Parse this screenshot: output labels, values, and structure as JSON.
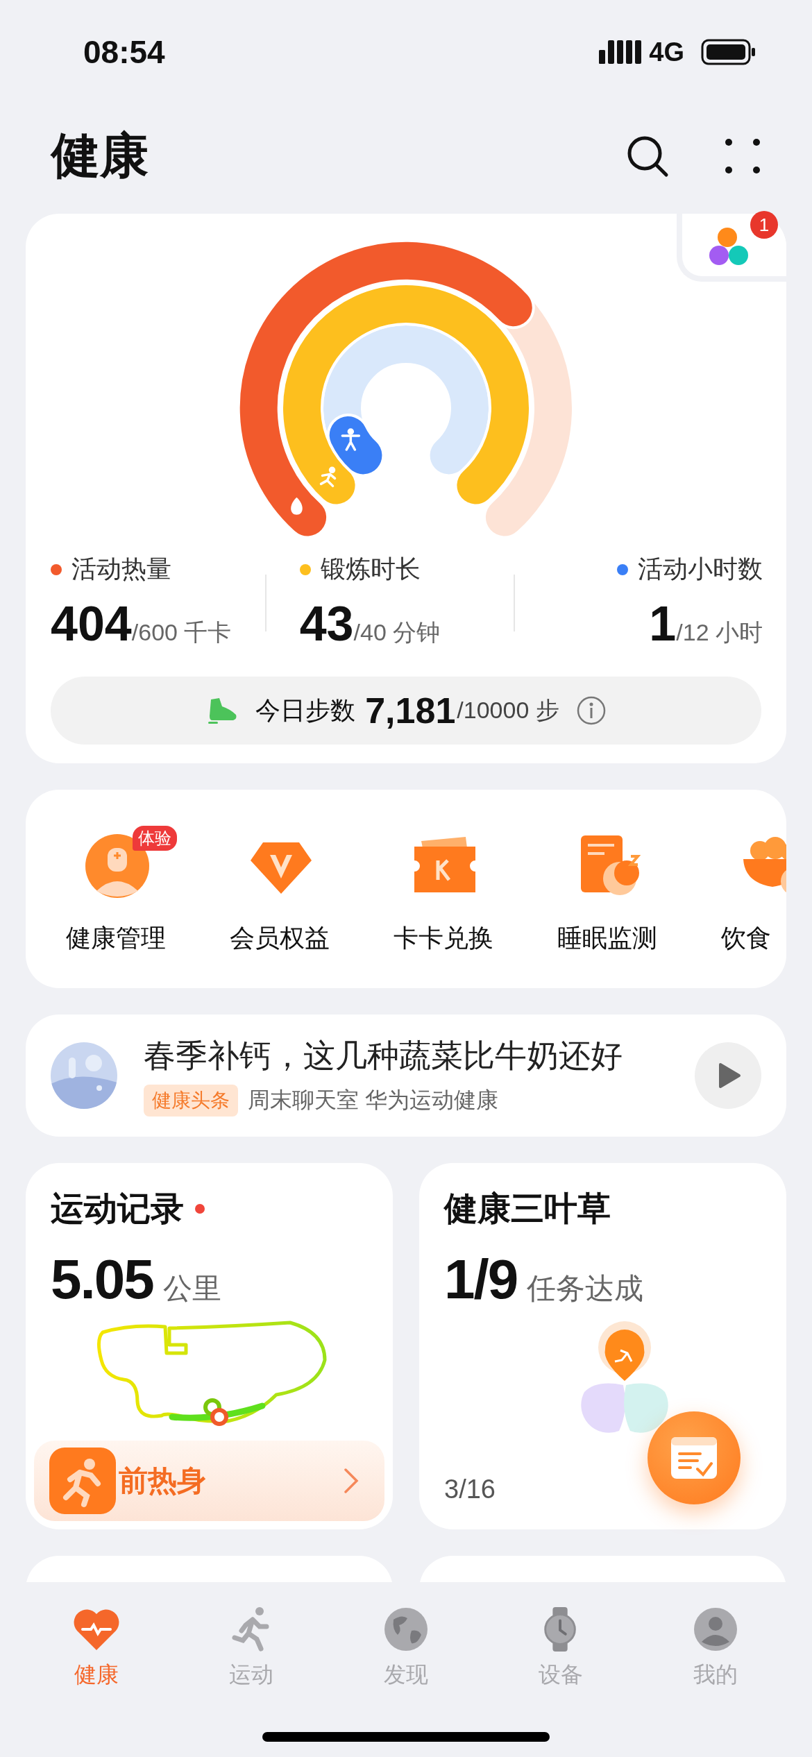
{
  "status_bar": {
    "time": "08:54",
    "network": "4G"
  },
  "header": {
    "title": "健康"
  },
  "activity": {
    "badge": "1",
    "rings": [
      {
        "kind": "calories",
        "label": "活动热量",
        "value": "404",
        "target": "/600 千卡",
        "color": "#f25a2c"
      },
      {
        "kind": "exercise",
        "label": "锻炼时长",
        "value": "43",
        "target": "/40 分钟",
        "color": "#fdbf1e"
      },
      {
        "kind": "hours",
        "label": "活动小时数",
        "value": "1",
        "target": "/12 小时",
        "color": "#3a7ff6"
      }
    ]
  },
  "steps": {
    "label": "今日步数",
    "value": "7,181",
    "target": "/10000 步"
  },
  "shortcuts": [
    {
      "kind": "doctor",
      "label": "健康管理",
      "badge": "体验"
    },
    {
      "kind": "diamond",
      "label": "会员权益"
    },
    {
      "kind": "ticket",
      "label": "卡卡兑换"
    },
    {
      "kind": "sleep",
      "label": "睡眠监测"
    },
    {
      "kind": "food",
      "label": "饮食"
    }
  ],
  "news": {
    "title": "春季补钙，这几种蔬菜比牛奶还好",
    "tag": "健康头条",
    "source": "周末聊天室 华为运动健康"
  },
  "cards": [
    {
      "kind": "exercise",
      "title": "运动记录",
      "new": true,
      "value": "5.05",
      "unit": "公里",
      "action": "前热身"
    },
    {
      "kind": "clover",
      "title": "健康三叶草",
      "value": "1/9",
      "unit": "任务达成",
      "footer": "3/16"
    }
  ],
  "tabs": [
    {
      "kind": "heart",
      "label": "健康",
      "selected": true
    },
    {
      "kind": "run",
      "label": "运动",
      "selected": false
    },
    {
      "kind": "globe",
      "label": "发现",
      "selected": false
    },
    {
      "kind": "watch",
      "label": "设备",
      "selected": false
    },
    {
      "kind": "person",
      "label": "我的",
      "selected": false
    }
  ]
}
